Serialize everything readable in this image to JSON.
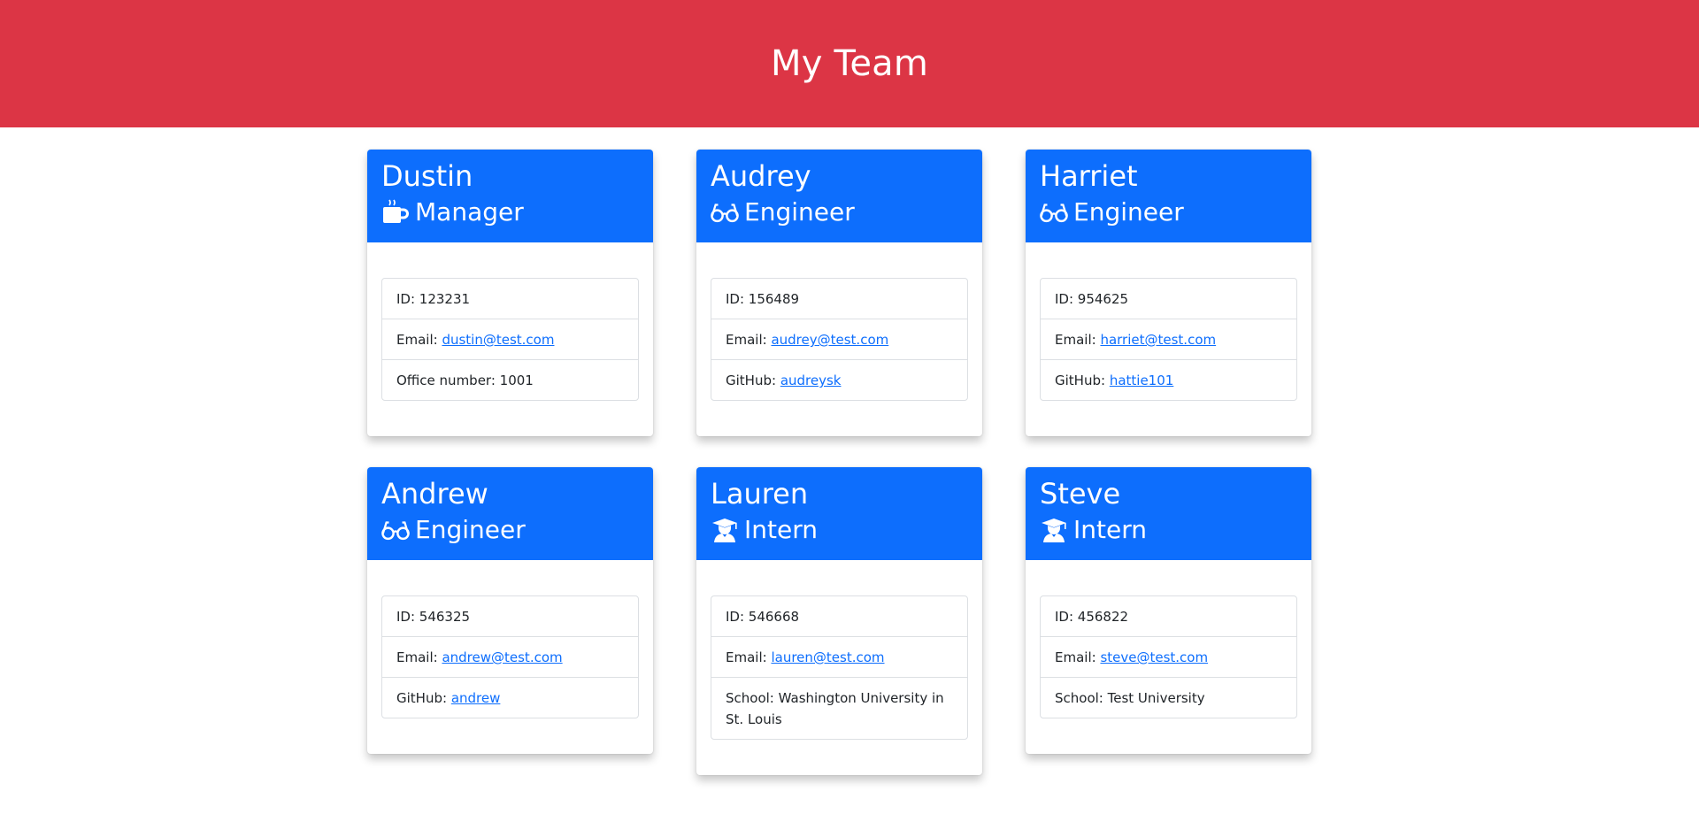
{
  "header": {
    "title": "My Team",
    "bg_color": "#dc3545"
  },
  "colors": {
    "card_header": "#0d6efd",
    "link": "#0d6efd"
  },
  "employees": [
    {
      "name": "Dustin",
      "role": "Manager",
      "icon": "coffee-mug-icon",
      "id_label": "ID: ",
      "id": "123231",
      "email_label": "Email: ",
      "email": "dustin@test.com",
      "extra_label": "Office number: ",
      "extra": "1001",
      "extra_is_link": false
    },
    {
      "name": "Audrey",
      "role": "Engineer",
      "icon": "glasses-icon",
      "id_label": "ID: ",
      "id": "156489",
      "email_label": "Email: ",
      "email": "audrey@test.com",
      "extra_label": "GitHub: ",
      "extra": "audreysk",
      "extra_is_link": true
    },
    {
      "name": "Harriet",
      "role": "Engineer",
      "icon": "glasses-icon",
      "id_label": "ID: ",
      "id": "954625",
      "email_label": "Email: ",
      "email": "harriet@test.com",
      "extra_label": "GitHub: ",
      "extra": "hattie101",
      "extra_is_link": true
    },
    {
      "name": "Andrew",
      "role": "Engineer",
      "icon": "glasses-icon",
      "id_label": "ID: ",
      "id": "546325",
      "email_label": "Email: ",
      "email": "andrew@test.com",
      "extra_label": "GitHub: ",
      "extra": "andrew",
      "extra_is_link": true
    },
    {
      "name": "Lauren",
      "role": "Intern",
      "icon": "graduate-icon",
      "id_label": "ID: ",
      "id": "546668",
      "email_label": "Email: ",
      "email": "lauren@test.com",
      "extra_label": "School: ",
      "extra": "Washington University in St. Louis",
      "extra_is_link": false
    },
    {
      "name": "Steve",
      "role": "Intern",
      "icon": "graduate-icon",
      "id_label": "ID: ",
      "id": "456822",
      "email_label": "Email: ",
      "email": "steve@test.com",
      "extra_label": "School: ",
      "extra": "Test University",
      "extra_is_link": false
    }
  ]
}
